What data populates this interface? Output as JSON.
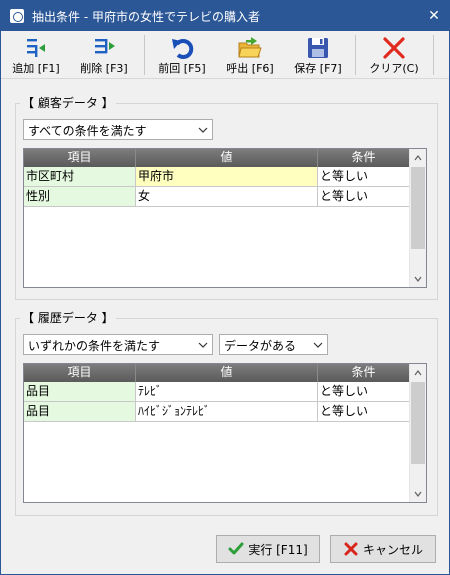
{
  "window": {
    "title": "抽出条件 - 甲府市の女性でテレビの購入者",
    "close_symbol": "✕"
  },
  "toolbar": {
    "add": "追加 [F1]",
    "delete": "削除 [F3]",
    "previous": "前回 [F5]",
    "load": "呼出 [F6]",
    "save": "保存 [F7]",
    "clear": "クリア(C)"
  },
  "customer": {
    "title": "【 顧客データ 】",
    "match_mode": "すべての条件を満たす",
    "columns": [
      "項目",
      "値",
      "条件"
    ],
    "rows": [
      {
        "field": "市区町村",
        "value": "甲府市",
        "condition": "と等しい"
      },
      {
        "field": "性別",
        "value": "女",
        "condition": "と等しい"
      }
    ]
  },
  "history": {
    "title": "【 履歴データ 】",
    "match_mode": "いずれかの条件を満たす",
    "existence": "データがある",
    "columns": [
      "項目",
      "値",
      "条件"
    ],
    "rows": [
      {
        "field": "品目",
        "value": "ﾃﾚﾋﾞ",
        "condition": "と等しい"
      },
      {
        "field": "品目",
        "value": "ﾊｲﾋﾞｼﾞｮﾝﾃﾚﾋﾞ",
        "condition": "と等しい"
      }
    ]
  },
  "footer": {
    "run": "実行 [F11]",
    "cancel": "キャンセル"
  },
  "colors": {
    "titlebar": "#2b5797",
    "field_cell": "#e5f9e0",
    "selected_value_cell": "#ffffc0",
    "grid_header": "#6a6a6a"
  }
}
